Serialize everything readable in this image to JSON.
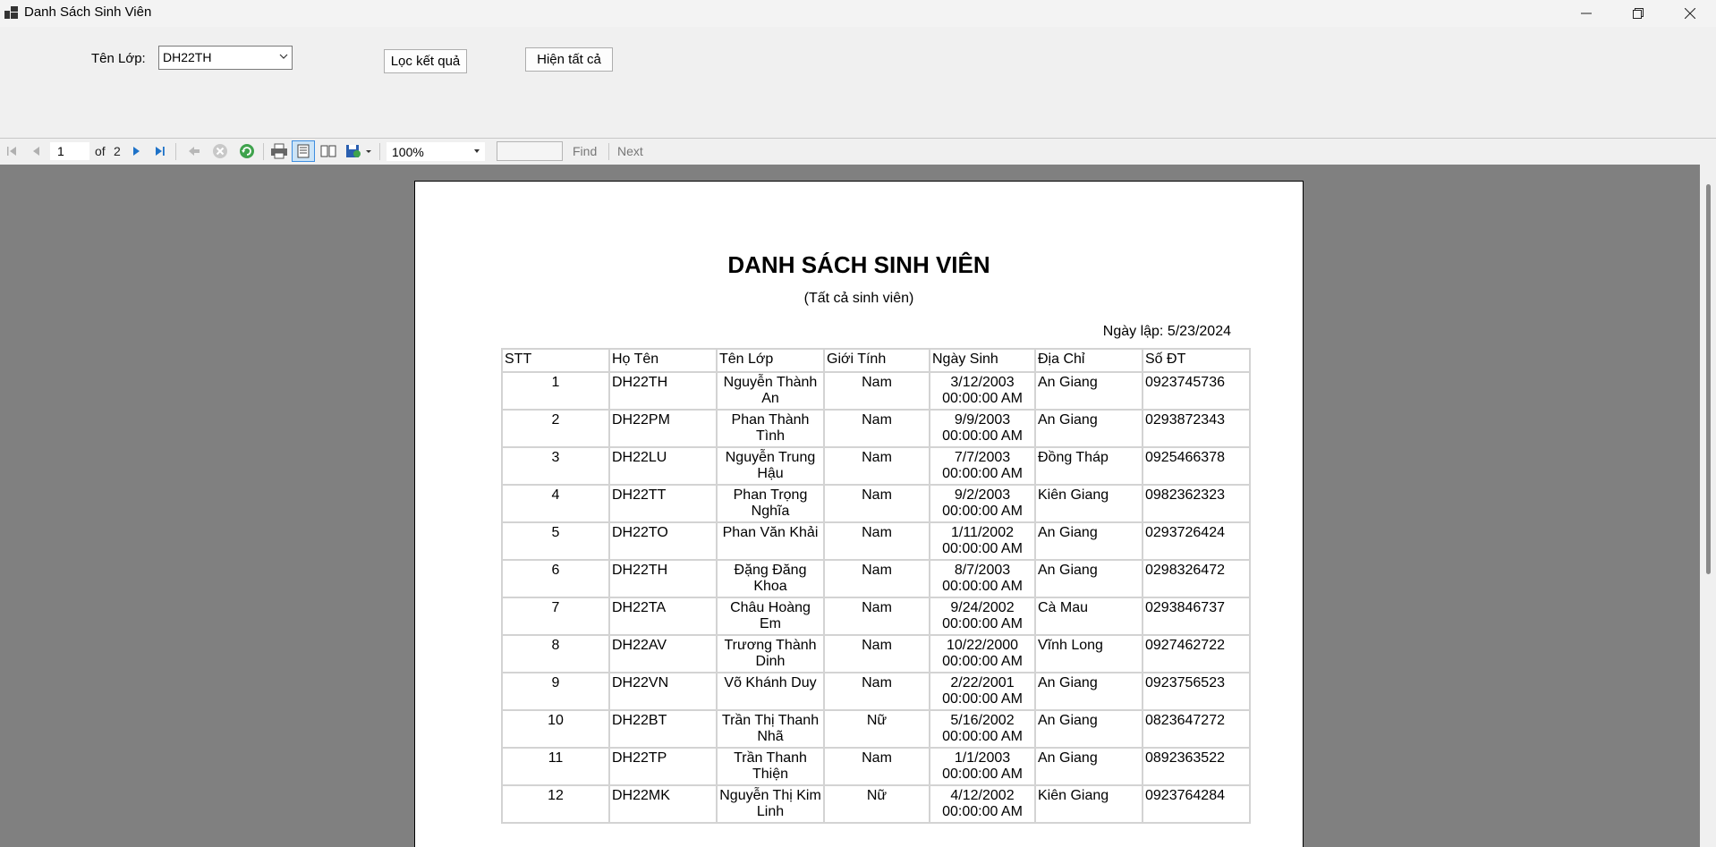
{
  "window": {
    "title": "Danh Sách Sinh Viên"
  },
  "form": {
    "class_label": "Tên Lớp:",
    "class_value": "DH22TH",
    "filter_button": "Lọc kết quả",
    "show_all_button": "Hiện tất cả"
  },
  "toolbar": {
    "page_current": "1",
    "page_of": "of",
    "page_total": "2",
    "zoom": "100%",
    "find_label": "Find",
    "next_label": "Next"
  },
  "report": {
    "title": "DANH SÁCH SINH VIÊN",
    "subtitle": "(Tất cả sinh viên)",
    "date_text": "Ngày lập: 5/23/2024",
    "columns": [
      "STT",
      "Họ Tên",
      "Tên Lớp",
      "Giới Tính",
      "Ngày Sinh",
      "Địa Chỉ",
      "Số ĐT"
    ],
    "rows": [
      {
        "stt": "1",
        "col2": "DH22TH",
        "col3": "Nguyễn Thành An",
        "gt": "Nam",
        "ns": "3/12/2003 00:00:00 AM",
        "dc": "An Giang",
        "sdt": "0923745736"
      },
      {
        "stt": "2",
        "col2": "DH22PM",
        "col3": "Phan Thành Tình",
        "gt": "Nam",
        "ns": "9/9/2003 00:00:00 AM",
        "dc": "An Giang",
        "sdt": "0293872343"
      },
      {
        "stt": "3",
        "col2": "DH22LU",
        "col3": "Nguyễn Trung Hậu",
        "gt": "Nam",
        "ns": "7/7/2003 00:00:00 AM",
        "dc": "Đồng Tháp",
        "sdt": "0925466378"
      },
      {
        "stt": "4",
        "col2": "DH22TT",
        "col3": "Phan Trọng Nghĩa",
        "gt": "Nam",
        "ns": "9/2/2003 00:00:00 AM",
        "dc": "Kiên Giang",
        "sdt": "0982362323"
      },
      {
        "stt": "5",
        "col2": "DH22TO",
        "col3": "Phan Văn Khải",
        "gt": "Nam",
        "ns": "1/11/2002 00:00:00 AM",
        "dc": "An Giang",
        "sdt": "0293726424"
      },
      {
        "stt": "6",
        "col2": "DH22TH",
        "col3": "Đặng Đăng Khoa",
        "gt": "Nam",
        "ns": "8/7/2003 00:00:00 AM",
        "dc": "An Giang",
        "sdt": "0298326472"
      },
      {
        "stt": "7",
        "col2": "DH22TA",
        "col3": "Châu Hoàng Em",
        "gt": "Nam",
        "ns": "9/24/2002 00:00:00 AM",
        "dc": "Cà Mau",
        "sdt": "0293846737"
      },
      {
        "stt": "8",
        "col2": "DH22AV",
        "col3": "Trương Thành Dinh",
        "gt": "Nam",
        "ns": "10/22/2000 00:00:00 AM",
        "dc": "Vĩnh Long",
        "sdt": "0927462722"
      },
      {
        "stt": "9",
        "col2": "DH22VN",
        "col3": "Võ Khánh Duy",
        "gt": "Nam",
        "ns": "2/22/2001 00:00:00 AM",
        "dc": "An Giang",
        "sdt": "0923756523"
      },
      {
        "stt": "10",
        "col2": "DH22BT",
        "col3": "Trần Thị Thanh Nhã",
        "gt": "Nữ",
        "ns": "5/16/2002 00:00:00 AM",
        "dc": "An Giang",
        "sdt": "0823647272"
      },
      {
        "stt": "11",
        "col2": "DH22TP",
        "col3": "Trần Thanh Thiện",
        "gt": "Nam",
        "ns": "1/1/2003 00:00:00 AM",
        "dc": "An Giang",
        "sdt": "0892363522"
      },
      {
        "stt": "12",
        "col2": "DH22MK",
        "col3": "Nguyễn Thị Kim Linh",
        "gt": "Nữ",
        "ns": "4/12/2002 00:00:00 AM",
        "dc": "Kiên Giang",
        "sdt": "0923764284"
      }
    ]
  }
}
